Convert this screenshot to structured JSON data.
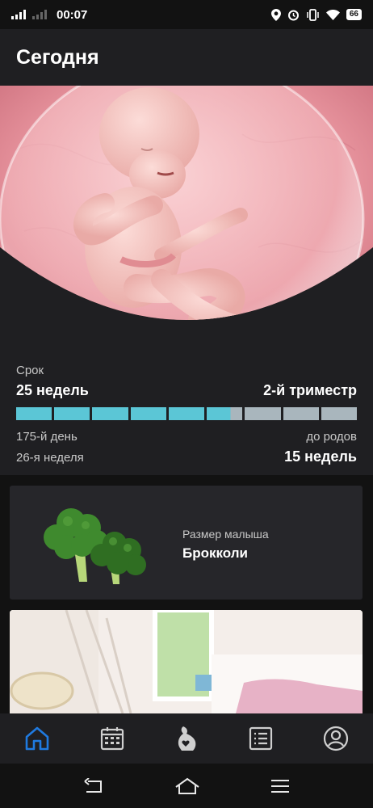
{
  "status_bar": {
    "time": "00:07",
    "battery": "66"
  },
  "header": {
    "title": "Сегодня"
  },
  "hero": {
    "image": "fetus-in-womb-illustration"
  },
  "pregnancy": {
    "term_label": "Срок",
    "weeks_value": "25 недель",
    "trimester": "2-й триместр",
    "progress_segments_total": 9,
    "progress_fraction": 0.63,
    "day_label": "175-й день",
    "week_label": "26-я неделя",
    "until_birth_label": "до родов",
    "until_birth_value": "15 недель"
  },
  "baby_size": {
    "label": "Размер малыша",
    "value": "Брокколи",
    "image": "broccoli"
  },
  "article": {
    "image": "nursery-room-photo"
  },
  "bottom_nav": [
    {
      "name": "home",
      "icon": "home-icon",
      "active": true
    },
    {
      "name": "calendar",
      "icon": "calendar-icon",
      "active": false
    },
    {
      "name": "pregnancy",
      "icon": "pregnant-belly-icon",
      "active": false
    },
    {
      "name": "list",
      "icon": "list-icon",
      "active": false
    },
    {
      "name": "profile",
      "icon": "profile-icon",
      "active": false
    }
  ],
  "colors": {
    "accent": "#1f7ae0",
    "progress_filled": "#5bc6d6",
    "progress_empty": "#a9b6bd",
    "background": "#1f1f22",
    "card": "#26262a"
  }
}
